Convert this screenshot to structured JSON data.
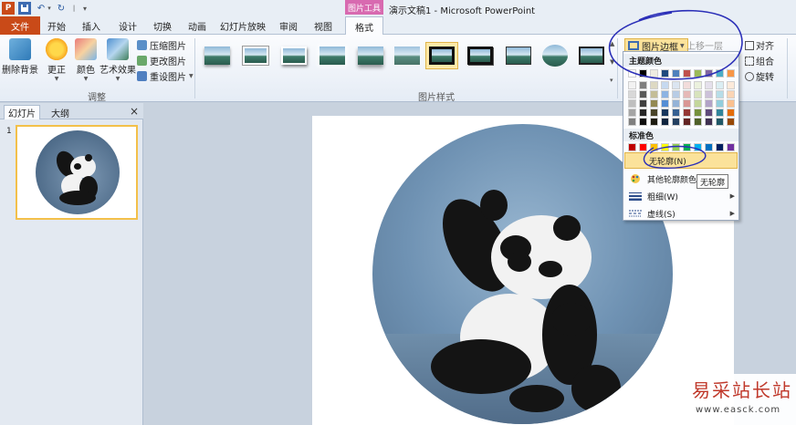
{
  "quick_access": {
    "ppt_logo": "P",
    "separator": "|",
    "customize": "▾"
  },
  "context_tab_header": "图片工具",
  "window_title": "演示文稿1 - Microsoft PowerPoint",
  "tabs": {
    "file": "文件",
    "home": "开始",
    "insert": "插入",
    "design": "设计",
    "transitions": "切换",
    "animations": "动画",
    "slideshow": "幻灯片放映",
    "review": "审阅",
    "view": "视图",
    "format": "格式"
  },
  "ribbon": {
    "remove_background": "删除背景",
    "corrections": "更正",
    "color": "颜色",
    "artistic_effects": "艺术效果",
    "compress": "压缩图片",
    "change_picture": "更改图片",
    "reset_picture": "重设图片",
    "group_adjust": "调整",
    "group_styles": "图片样式",
    "picture_border": "图片边框",
    "bring_forward": "上移一层",
    "align": "对齐",
    "group": "组合",
    "rotate": "旋转"
  },
  "left_pane": {
    "tab_slides": "幻灯片",
    "tab_outline": "大纲",
    "close": "×",
    "slide_number": "1"
  },
  "menu": {
    "theme_colors": "主题颜色",
    "standard_colors": "标准色",
    "no_outline": "无轮廓(N)",
    "more_outline_colors": "其他轮廓颜色",
    "weight": "粗细(W)",
    "dashes": "虚线(S)"
  },
  "tooltip": "无轮廓",
  "theme_palette": {
    "top": [
      "#ffffff",
      "#000000",
      "#eeece1",
      "#1f497d",
      "#4f81bd",
      "#c0504d",
      "#9bbb59",
      "#8064a2",
      "#4bacc6",
      "#f79646"
    ],
    "shades": [
      [
        "#f2f2f2",
        "#7f7f7f",
        "#ddd9c3",
        "#c6d9f0",
        "#dbe5f1",
        "#f2dcdb",
        "#ebf1dd",
        "#e5e0ec",
        "#dbeef3",
        "#fdeada"
      ],
      [
        "#d8d8d8",
        "#595959",
        "#c4bd97",
        "#8db3e2",
        "#b8cce4",
        "#e5b9b7",
        "#d7e3bc",
        "#ccc1d9",
        "#b7dde8",
        "#fbd5b5"
      ],
      [
        "#bfbfbf",
        "#3f3f3f",
        "#938953",
        "#548dd4",
        "#95b3d7",
        "#d99694",
        "#c3d69b",
        "#b2a2c7",
        "#92cddc",
        "#fac08f"
      ],
      [
        "#a5a5a5",
        "#262626",
        "#494429",
        "#17365d",
        "#366092",
        "#953734",
        "#76923c",
        "#5f497a",
        "#31859b",
        "#e36c09"
      ],
      [
        "#7f7f7f",
        "#0c0c0c",
        "#1d1b10",
        "#0f243e",
        "#244061",
        "#632423",
        "#4f6128",
        "#3f3151",
        "#205867",
        "#974806"
      ]
    ]
  },
  "standard_palette": [
    "#c00000",
    "#ff0000",
    "#ffc000",
    "#ffff00",
    "#92d050",
    "#00b050",
    "#00b0f0",
    "#0070c0",
    "#002060",
    "#7030a0"
  ],
  "annotation_color": "#2b2fb8",
  "watermark": {
    "chinese": "易采站长站",
    "url": "www.easck.com"
  }
}
